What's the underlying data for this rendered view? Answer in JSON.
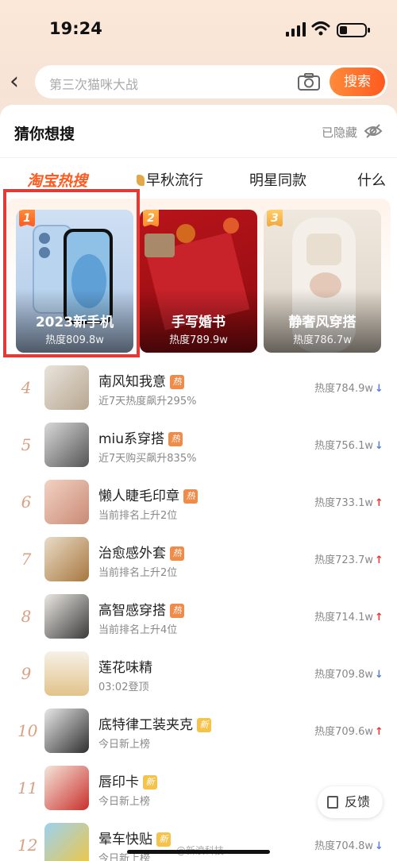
{
  "status": {
    "time": "19:24"
  },
  "search": {
    "placeholder": "第三次猫咪大战",
    "button": "搜索"
  },
  "section": {
    "title": "猜你想搜",
    "hidden_label": "已隐藏"
  },
  "tabs": [
    {
      "label": "淘宝热搜",
      "active": true
    },
    {
      "label": "早秋流行"
    },
    {
      "label": "明星同款"
    },
    {
      "label": "什么"
    }
  ],
  "top3": [
    {
      "rank": "1",
      "title": "2023新手机",
      "heat": "热度809.8w"
    },
    {
      "rank": "2",
      "title": "手写婚书",
      "heat": "热度789.9w"
    },
    {
      "rank": "3",
      "title": "静奢风穿搭",
      "heat": "热度786.7w"
    }
  ],
  "list": [
    {
      "rank": "4",
      "title": "南风知我意",
      "badge": "热",
      "sub": "近7天热度飙升295%",
      "heat": "热度784.9w",
      "trend": "down"
    },
    {
      "rank": "5",
      "title": "miu系穿搭",
      "badge": "热",
      "sub": "近7天购买飙升835%",
      "heat": "热度756.1w",
      "trend": "down"
    },
    {
      "rank": "6",
      "title": "懒人睫毛印章",
      "badge": "热",
      "sub": "当前排名上升2位",
      "heat": "热度733.1w",
      "trend": "up"
    },
    {
      "rank": "7",
      "title": "治愈感外套",
      "badge": "热",
      "sub": "当前排名上升2位",
      "heat": "热度723.7w",
      "trend": "up"
    },
    {
      "rank": "8",
      "title": "高智感穿搭",
      "badge": "热",
      "sub": "当前排名上升4位",
      "heat": "热度714.1w",
      "trend": "up"
    },
    {
      "rank": "9",
      "title": "莲花味精",
      "badge": "",
      "sub": "03:02登顶",
      "heat": "热度709.8w",
      "trend": "down"
    },
    {
      "rank": "10",
      "title": "底特律工装夹克",
      "badge": "新",
      "sub": "今日新上榜",
      "heat": "热度709.6w",
      "trend": "up"
    },
    {
      "rank": "11",
      "title": "唇印卡",
      "badge": "新",
      "sub": "今日新上榜",
      "heat": "",
      "trend": ""
    },
    {
      "rank": "12",
      "title": "晕车快贴",
      "badge": "新",
      "sub": "今日新上榜",
      "heat": "热度704.8w",
      "trend": "down"
    }
  ],
  "feedback": "反馈",
  "watermark": "@新浪科技",
  "colors": {
    "accent": "#ff5a1f",
    "highlight_box": "#e53935",
    "trend_up": "#e53935",
    "trend_down": "#5b7fd8"
  }
}
